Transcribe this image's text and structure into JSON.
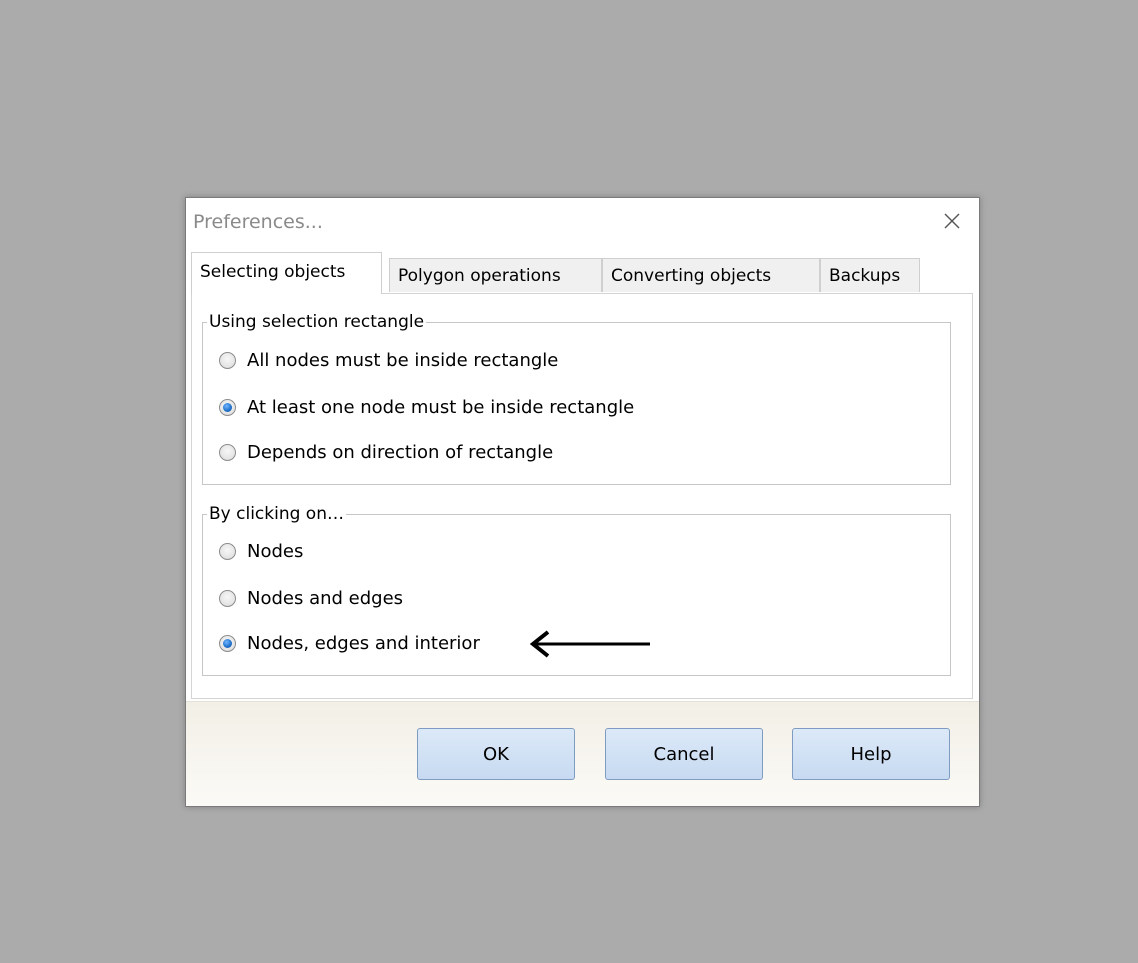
{
  "dialog": {
    "title": "Preferences...",
    "close_icon": "close-icon"
  },
  "tabs": [
    {
      "label": "Selecting objects",
      "active": true
    },
    {
      "label": "Polygon operations",
      "active": false
    },
    {
      "label": "Converting objects",
      "active": false
    },
    {
      "label": "Backups",
      "active": false
    }
  ],
  "selection_rectangle": {
    "legend": "Using selection rectangle",
    "options": [
      {
        "label": "All nodes must be inside rectangle",
        "checked": false
      },
      {
        "label": "At least one node must be inside rectangle",
        "checked": true
      },
      {
        "label": "Depends on direction of rectangle",
        "checked": false
      }
    ]
  },
  "clicking": {
    "legend": "By clicking on…",
    "options": [
      {
        "label": "Nodes",
        "checked": false
      },
      {
        "label": "Nodes and edges",
        "checked": false
      },
      {
        "label": "Nodes, edges and interior",
        "checked": true
      }
    ]
  },
  "buttons": {
    "ok": "OK",
    "cancel": "Cancel",
    "help": "Help"
  },
  "annotation": {
    "icon": "left-arrow-icon",
    "color": "#000000"
  },
  "colors": {
    "background": "#ababab",
    "radio_accent": "#1f6fc9",
    "button_fill": "#c7daf1"
  }
}
